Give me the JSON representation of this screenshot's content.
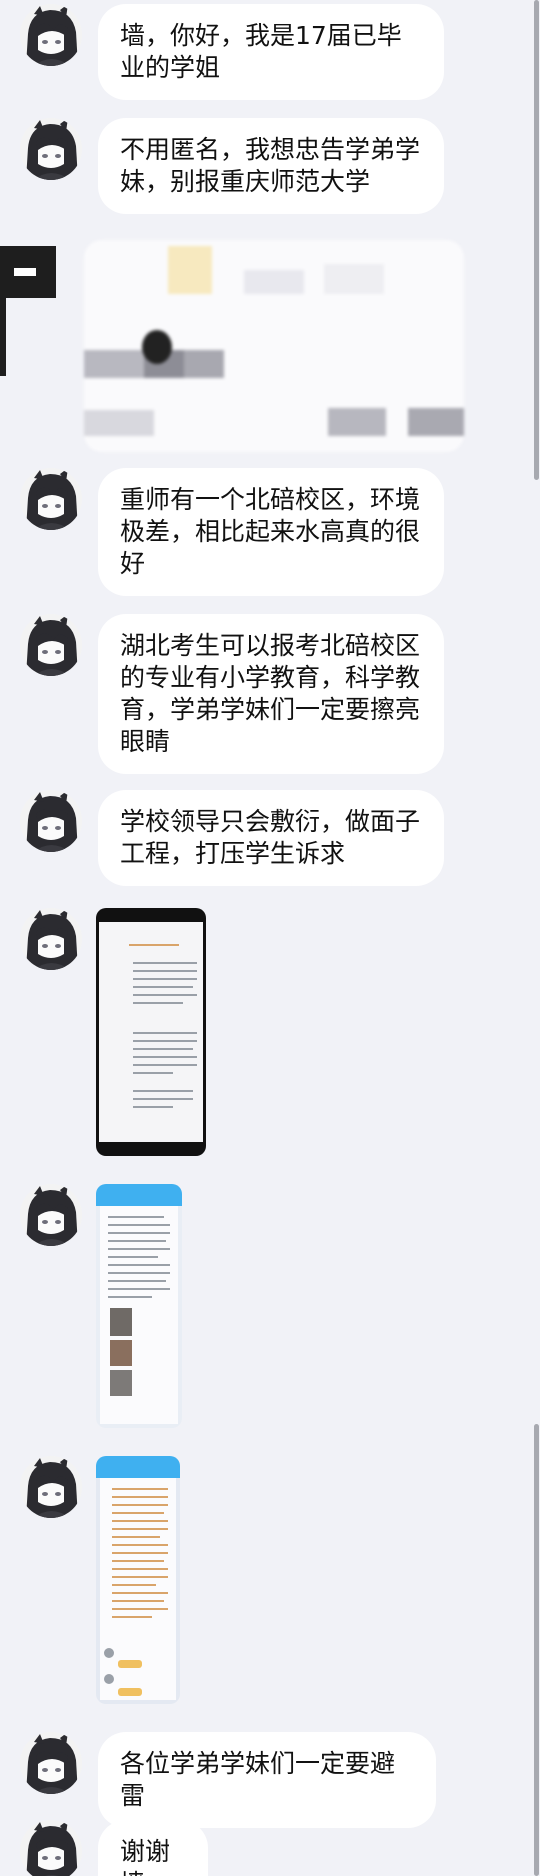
{
  "messages": [
    {
      "text": "墙，你好，我是17届已毕业的学姐"
    },
    {
      "text": "不用匿名，我想忠告学弟学妹，别报重庆师范大学"
    },
    {
      "text": "重师有一个北碚校区，环境极差，相比起来水高真的很好"
    },
    {
      "text": "湖北考生可以报考北碚校区的专业有小学教育，科学教育，学弟学妹们一定要擦亮眼睛"
    },
    {
      "text": "学校领导只会敷衍，做面子工程，打压学生诉求"
    },
    {
      "text": "各位学弟学妹们一定要避雷"
    },
    {
      "text": "谢谢墙"
    }
  ],
  "colors": {
    "background": "#f1f2f7",
    "bubble": "#ffffff",
    "phone_frame": "#111111",
    "blue_header": "#3fb0f0"
  },
  "icons": {
    "avatar": "anime-avatar-icon",
    "side_tab": "menu-dash-icon"
  }
}
